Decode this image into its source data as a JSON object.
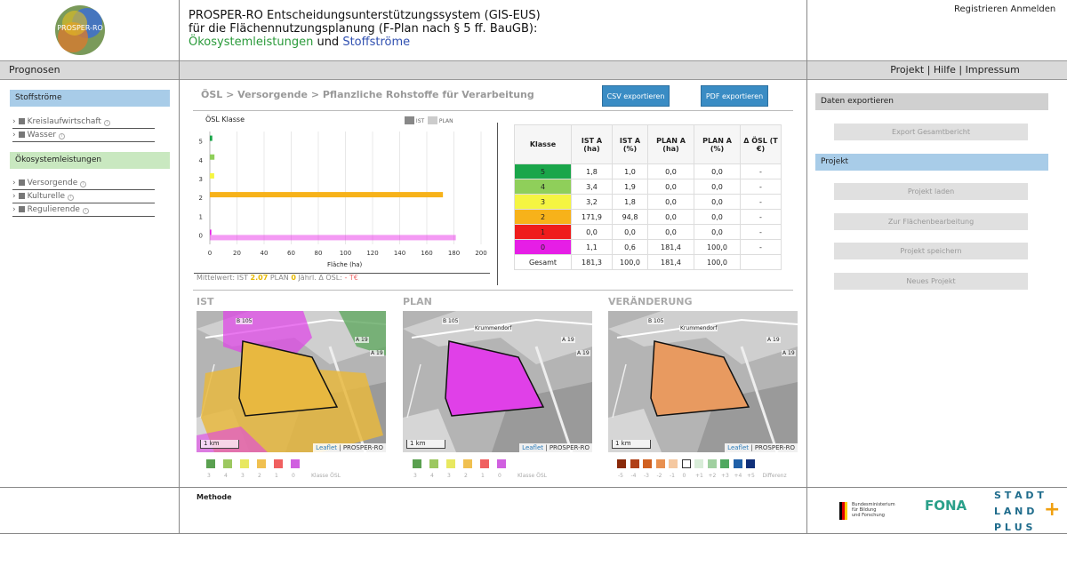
{
  "header": {
    "title_line1": "PROSPER-RO Entscheidungsunterstützungssystem (GIS-EUS)",
    "title_line2": "für die Flächennutzungsplanung (F-Plan nach § 5 ff. BauGB):",
    "title_line3_a": "Ökosystemleistungen",
    "title_line3_b": "und",
    "title_line3_c": "Stoffströme",
    "logo_text": "PROSPER-RO",
    "register": "Registrieren",
    "login": "Anmelden"
  },
  "bar": {
    "left": "Prognosen",
    "nav_project": "Projekt",
    "nav_help": "Hilfe",
    "nav_impressum": "Impressum",
    "sep": "|"
  },
  "sidebar": {
    "stoffstroeme": "Stoffströme",
    "items1": [
      "Kreislaufwirtschaft",
      "Wasser"
    ],
    "oesl": "Ökosystemleistungen",
    "items2": [
      "Versorgende",
      "Kulturelle",
      "Regulierende"
    ],
    "info": "i"
  },
  "main": {
    "breadcrumb": "ÖSL > Versorgende > Pflanzliche Rohstoffe für Verarbeitung",
    "csv": "CSV exportieren",
    "pdf": "PDF exportieren"
  },
  "chart_data": {
    "type": "bar",
    "title": "ÖSL Klasse",
    "xlabel": "Fläche (ha)",
    "categories": [
      "5",
      "4",
      "3",
      "2",
      "1",
      "0"
    ],
    "series": [
      {
        "name": "IST",
        "values": [
          1.8,
          3.4,
          3.2,
          171.9,
          0.0,
          1.1
        ],
        "color": "#888888"
      },
      {
        "name": "PLAN",
        "values": [
          0.0,
          0.0,
          0.0,
          0.0,
          0.0,
          181.4
        ],
        "color": "#cccccc"
      }
    ],
    "bar_colors": [
      "#1aa64a",
      "#8fcf5a",
      "#f5f542",
      "#f7b21a",
      "#ef1c1c",
      "#e61ee6"
    ],
    "xlim": [
      0,
      200
    ],
    "xticks": [
      "0",
      "20",
      "40",
      "60",
      "80",
      "100",
      "120",
      "140",
      "160",
      "180",
      "200"
    ],
    "mean_label": "Mittelwert: IST",
    "mean_ist": "2.07",
    "mean_plan_label": "PLAN",
    "mean_plan": "0",
    "jaehrl_label": "Jährl. Δ ÖSL:",
    "jaehrl_value": "- T€"
  },
  "table": {
    "headers": [
      "Klasse",
      "IST A (ha)",
      "IST A (%)",
      "PLAN A (ha)",
      "PLAN A (%)",
      "Δ ÖSL (T €)"
    ],
    "rows": [
      {
        "k": "5",
        "color": "#1aa64a",
        "v": [
          "1,8",
          "1,0",
          "0,0",
          "0,0",
          "-"
        ]
      },
      {
        "k": "4",
        "color": "#8fcf5a",
        "v": [
          "3,4",
          "1,9",
          "0,0",
          "0,0",
          "-"
        ]
      },
      {
        "k": "3",
        "color": "#f5f542",
        "v": [
          "3,2",
          "1,8",
          "0,0",
          "0,0",
          "-"
        ]
      },
      {
        "k": "2",
        "color": "#f7b21a",
        "v": [
          "171,9",
          "94,8",
          "0,0",
          "0,0",
          "-"
        ]
      },
      {
        "k": "1",
        "color": "#ef1c1c",
        "v": [
          "0,0",
          "0,0",
          "0,0",
          "0,0",
          "-"
        ]
      },
      {
        "k": "0",
        "color": "#e61ee6",
        "v": [
          "1,1",
          "0,6",
          "181,4",
          "100,0",
          "-"
        ]
      }
    ],
    "total": {
      "k": "Gesamt",
      "v": [
        "181,3",
        "100,0",
        "181,4",
        "100,0",
        ""
      ]
    }
  },
  "maps": {
    "ist": "IST",
    "plan": "PLAN",
    "change": "VERÄNDERUNG",
    "leaflet": "Leaflet",
    "prosper": "PROSPER-RO",
    "scale": "1 km",
    "labels": [
      "B 105",
      "A 19",
      "A 19",
      "Krummendorf"
    ],
    "legend_oesl": [
      "3",
      "4",
      "3",
      "2",
      "1",
      "0"
    ],
    "legend_oesl_colors": [
      "#5aa050",
      "#9cc860",
      "#e8e860",
      "#f0c050",
      "#f06060",
      "#d060e0"
    ],
    "legend_oesl_title": "Klasse ÖSL",
    "legend_diff": [
      "-5",
      "-4",
      "-3",
      "-2",
      "-1",
      "0",
      "+1",
      "+2",
      "+3",
      "+4",
      "+5"
    ],
    "legend_diff_colors": [
      "#8a2a0a",
      "#b04018",
      "#d06020",
      "#e89050",
      "#f5c8a0",
      "#ffffff",
      "#d8ecd8",
      "#a0d0a0",
      "#50a860",
      "#2060a8",
      "#10307a"
    ],
    "legend_diff_title": "Differenz"
  },
  "right": {
    "daten": "Daten exportieren",
    "export": "Export Gesamtbericht",
    "projekt": "Projekt",
    "laden": "Projekt laden",
    "flaeche": "Zur Flächenbearbeitung",
    "speichern": "Projekt speichern",
    "neues": "Neues Projekt"
  },
  "footer": {
    "methode": "Methode",
    "bmbf_line1": "Bundesministerium",
    "bmbf_line2": "für Bildung",
    "bmbf_line3": "und Forschung",
    "fona": "FONA",
    "stadt": "S T A D T",
    "land": "L A N D",
    "plus": "P L U S",
    "plus_sign": "+"
  }
}
